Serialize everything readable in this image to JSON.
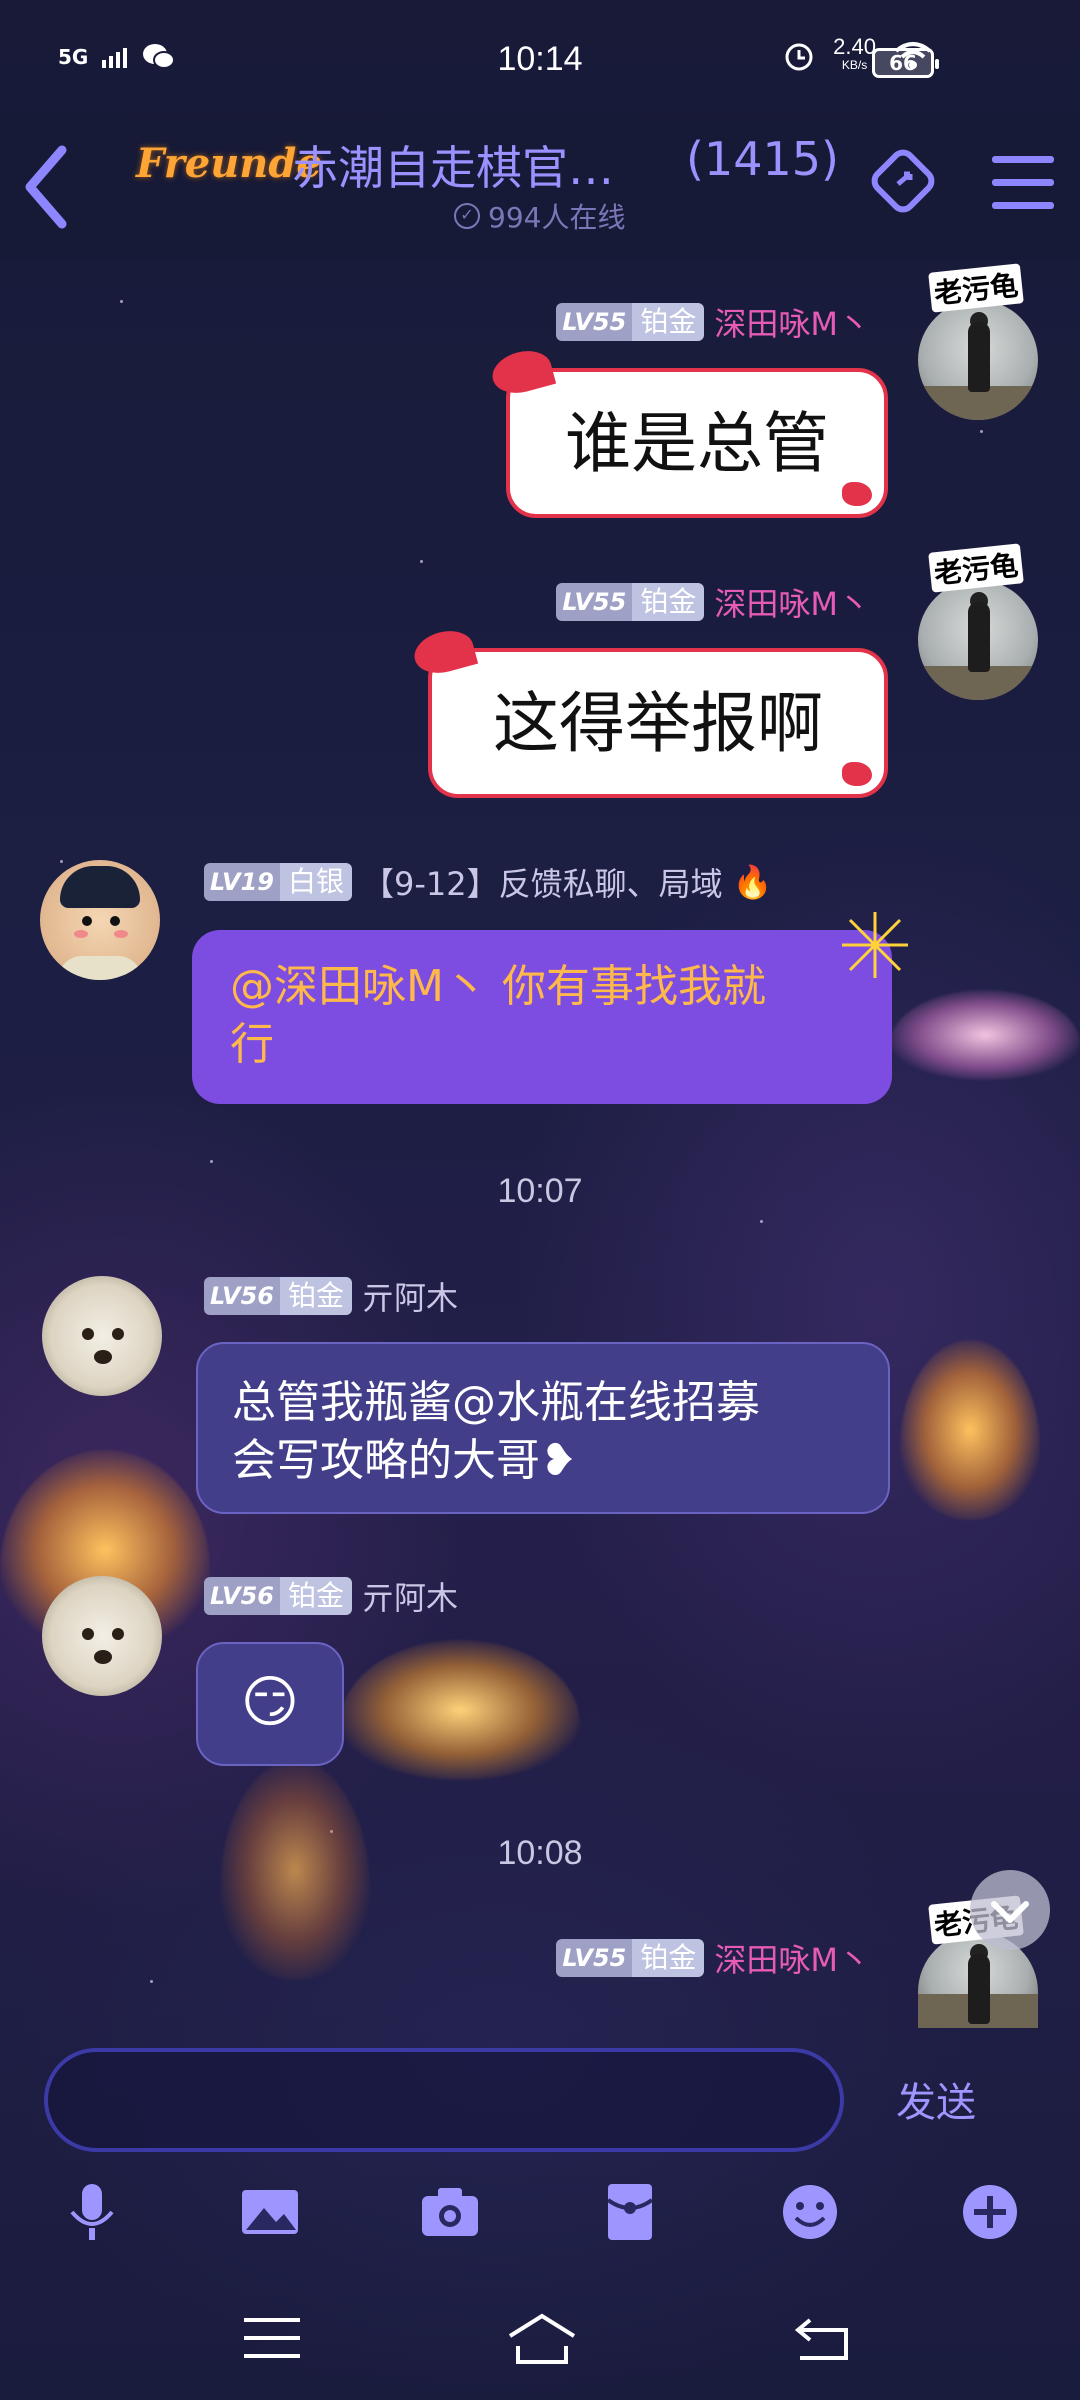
{
  "status_bar": {
    "network": "5G",
    "time": "10:14",
    "speed_value": "2.40",
    "speed_unit": "KB/s",
    "battery": "66"
  },
  "header": {
    "brand_logo": "Freunde",
    "group_title": "赤潮自走棋官…",
    "member_count": "(1415)",
    "online_text": "994人在线",
    "accent_color": "#9a92ff"
  },
  "messages": [
    {
      "side": "right",
      "level": "LV55",
      "rank": "铂金",
      "nickname": "深田咏M丶",
      "text": "谁是总管",
      "avatar_tag": "老污龟"
    },
    {
      "side": "right",
      "level": "LV55",
      "rank": "铂金",
      "nickname": "深田咏M丶",
      "text": "这得举报啊",
      "avatar_tag": "老污龟"
    },
    {
      "side": "left",
      "level": "LV19",
      "rank": "白银",
      "nickname": "【9-12】反馈私聊、局域",
      "badge_icon": "fire-icon",
      "text_line1": "@深田咏M丶 你有事找我就",
      "text_line2": "行"
    },
    {
      "side": "left",
      "level": "LV56",
      "rank": "铂金",
      "nickname": "亓阿木",
      "text_line1": "总管我瓶酱@水瓶在线招募",
      "text_line2": "会写攻略的大哥❥"
    },
    {
      "side": "left",
      "level": "LV56",
      "rank": "铂金",
      "nickname": "亓阿木",
      "emoji": "😏"
    },
    {
      "side": "right",
      "level": "LV55",
      "rank": "铂金",
      "nickname": "深田咏M丶",
      "avatar_tag": "老污龟"
    }
  ],
  "timestamps": [
    "10:07",
    "10:08"
  ],
  "input": {
    "placeholder": "",
    "value": "",
    "send_label": "发送"
  },
  "toolbar_icons": [
    "microphone-icon",
    "image-icon",
    "camera-icon",
    "red-packet-icon",
    "emoji-icon",
    "plus-icon"
  ],
  "nav_icons": [
    "menu-icon",
    "home-icon",
    "back-icon"
  ]
}
